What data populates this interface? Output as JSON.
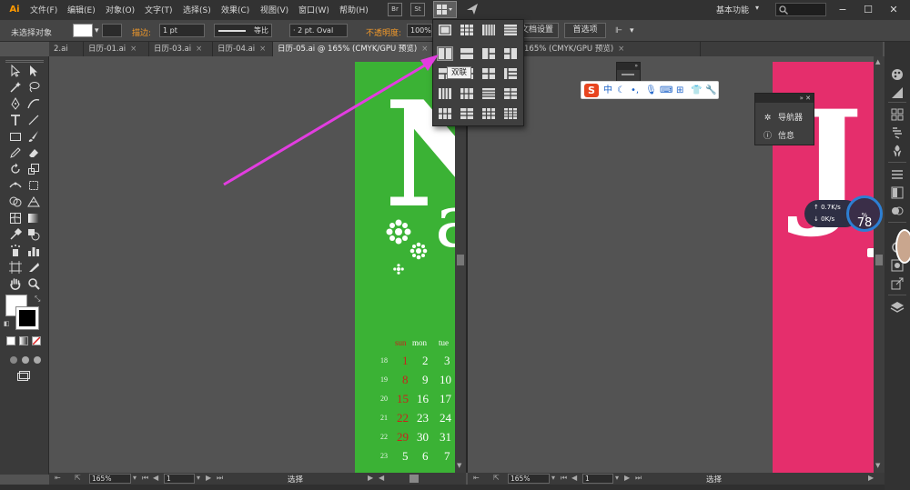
{
  "app": {
    "logo": "Ai"
  },
  "menubar": {
    "items": [
      "文件(F)",
      "编辑(E)",
      "对象(O)",
      "文字(T)",
      "选择(S)",
      "效果(C)",
      "视图(V)",
      "窗口(W)",
      "帮助(H)"
    ],
    "bridge_label": "Br",
    "stock_label": "St",
    "workspace_label": "基本功能",
    "window_controls": [
      "−",
      "☐",
      "✕"
    ]
  },
  "controlbar": {
    "selection_label": "未选择对象",
    "stroke_label": "描边:",
    "stroke_weight": "1 pt",
    "stroke_profile": "等比",
    "brush_label": "· 2 pt. Oval",
    "opacity_label": "不透明度:",
    "opacity_value": "100%",
    "document_setup_label": "文档设置",
    "preferences_label": "首选项"
  },
  "tabs": [
    {
      "label": "2.ai",
      "active": false
    },
    {
      "label": "日历-01.ai",
      "active": false
    },
    {
      "label": "日历-03.ai",
      "active": false
    },
    {
      "label": "日历-04.ai",
      "active": false
    },
    {
      "label": "日历-05.ai @ 165% (CMYK/GPU 预览)",
      "active": true
    },
    {
      "label": "165% (CMYK/GPU 预览)",
      "active": false
    }
  ],
  "arrange_menu": {
    "tooltip": "双联",
    "highlighted": "双联"
  },
  "calendar_left": {
    "headers": [
      "sun",
      "mon",
      "tue"
    ],
    "rows": [
      {
        "week": "18",
        "days": [
          "1",
          "2",
          "3"
        ]
      },
      {
        "week": "19",
        "days": [
          "8",
          "9",
          "10"
        ]
      },
      {
        "week": "20",
        "days": [
          "15",
          "16",
          "17"
        ]
      },
      {
        "week": "21",
        "days": [
          "22",
          "23",
          "24"
        ]
      },
      {
        "week": "22",
        "days": [
          "29",
          "30",
          "31"
        ]
      },
      {
        "week": "23",
        "days": [
          "5",
          "6",
          "7"
        ]
      }
    ],
    "big_letter": "N",
    "small_letter": "a"
  },
  "artboard_right": {
    "big_letter": "J"
  },
  "statusbar_left": {
    "zoom": "165%",
    "page": "1",
    "mode": "选择"
  },
  "statusbar_right": {
    "zoom": "165%",
    "page": "1",
    "mode": "选择"
  },
  "nav_panel": {
    "items": [
      "导航器",
      "信息"
    ]
  },
  "ime": {
    "mode": "中"
  },
  "speed_widget": {
    "percent": "78",
    "upload": "0.7",
    "download": "0",
    "unit": "K/s",
    "percent_sign": "%"
  },
  "colors": {
    "green_artboard": "#3bb235",
    "pink_artboard": "#e52e6c",
    "accent_arrow": "#e23de0",
    "ui_bg": "#535353"
  }
}
